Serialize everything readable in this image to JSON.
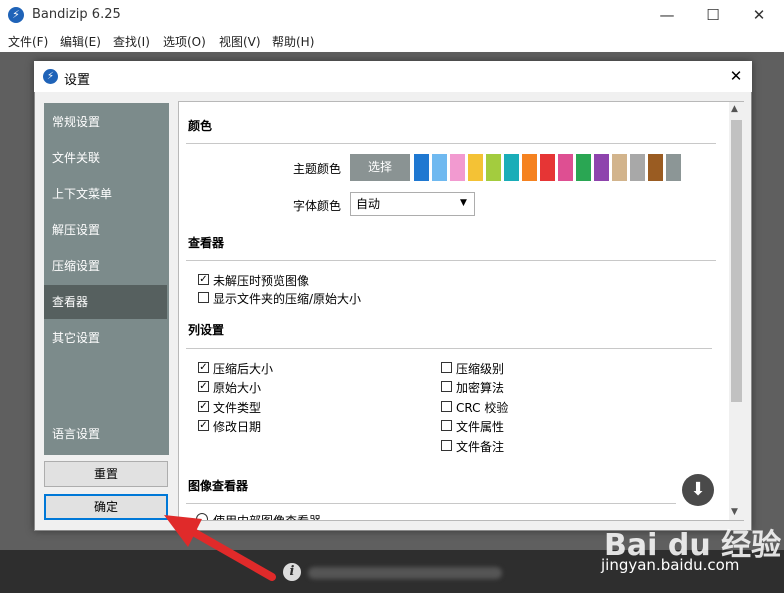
{
  "app": {
    "title": "Bandizip 6.25",
    "logo_glyph": "⚡"
  },
  "window_controls": {
    "minimize": "—",
    "maximize": "☐",
    "close": "✕"
  },
  "menu": [
    "文件(F)",
    "编辑(E)",
    "查找(I)",
    "选项(O)",
    "视图(V)",
    "帮助(H)"
  ],
  "dialog": {
    "title": "设置",
    "close": "✕",
    "nav": [
      "常规设置",
      "文件关联",
      "上下文菜单",
      "解压设置",
      "压缩设置",
      "查看器",
      "其它设置",
      "语言设置"
    ],
    "active_nav": "查看器",
    "reset_label": "重置",
    "ok_label": "确定"
  },
  "sections": {
    "color": {
      "title": "颜色",
      "theme_label": "主题颜色",
      "theme_button": "选择",
      "swatches": [
        "#1f78d1",
        "#6fb9f0",
        "#f29ad0",
        "#f4c235",
        "#a3cc3e",
        "#1aadb8",
        "#f58220",
        "#e63535",
        "#de4f92",
        "#2aa653",
        "#8e44ad",
        "#d2b48c",
        "#a8a8a8",
        "#9a5c22",
        "#8c9696"
      ],
      "font_label": "字体颜色",
      "font_value": "自动",
      "font_arrow": "▼"
    },
    "viewer": {
      "title": "查看器",
      "options": [
        {
          "label": "未解压时预览图像",
          "checked": true
        },
        {
          "label": "显示文件夹的压缩/原始大小",
          "checked": false
        }
      ]
    },
    "columns": {
      "title": "列设置",
      "left": [
        {
          "label": "压缩后大小",
          "checked": true
        },
        {
          "label": "原始大小",
          "checked": true
        },
        {
          "label": "文件类型",
          "checked": true
        },
        {
          "label": "修改日期",
          "checked": true
        }
      ],
      "right": [
        {
          "label": "压缩级别",
          "checked": false
        },
        {
          "label": "加密算法",
          "checked": false
        },
        {
          "label": "CRC 校验",
          "checked": false
        },
        {
          "label": "文件属性",
          "checked": false
        },
        {
          "label": "文件备注",
          "checked": false
        }
      ]
    },
    "image_viewer": {
      "title": "图像查看器",
      "partial_option": "使用内部图像查看器"
    }
  },
  "scroll": {
    "up": "▲",
    "down": "▼"
  },
  "download_glyph": "⬇",
  "info_glyph": "i",
  "watermark": {
    "brand": "Bai du 经验",
    "url": "jingyan.baidu.com"
  }
}
